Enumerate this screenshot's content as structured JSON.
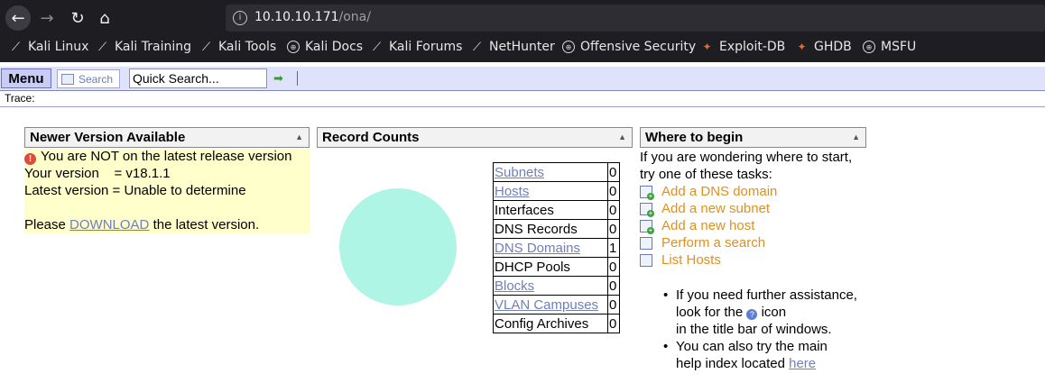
{
  "browser": {
    "url_host": "10.10.10.171",
    "url_path": "/ona/",
    "bookmarks": [
      {
        "label": "Kali Linux",
        "icon": "kali-dragon-icon"
      },
      {
        "label": "Kali Training",
        "icon": "kali-dragon-icon"
      },
      {
        "label": "Kali Tools",
        "icon": "kali-dragon-icon"
      },
      {
        "label": "Kali Docs",
        "icon": "globe-icon"
      },
      {
        "label": "Kali Forums",
        "icon": "kali-dragon-icon"
      },
      {
        "label": "NetHunter",
        "icon": "kali-dragon-icon"
      },
      {
        "label": "Offensive Security",
        "icon": "globe-icon"
      },
      {
        "label": "Exploit-DB",
        "icon": "exploit-db-icon"
      },
      {
        "label": "GHDB",
        "icon": "exploit-db-icon"
      },
      {
        "label": "MSFU",
        "icon": "globe-icon"
      }
    ]
  },
  "toolbar": {
    "menu_label": "Menu",
    "search_label": "Search",
    "quick_search_value": "Quick Search...",
    "trace_label": "Trace:"
  },
  "newer_version": {
    "title": "Newer Version Available",
    "warning": "You are NOT on the latest release version",
    "your_version": "Your version    = v18.1.1",
    "latest_version": "Latest version = Unable to determine",
    "please": "Please",
    "download_link": "DOWNLOAD",
    "after_link": "the latest version."
  },
  "record_counts": {
    "title": "Record Counts",
    "rows": [
      {
        "name": "Subnets",
        "count": "0",
        "link": true
      },
      {
        "name": "Hosts",
        "count": "0",
        "link": true
      },
      {
        "name": "Interfaces",
        "count": "0",
        "link": false
      },
      {
        "name": "DNS Records",
        "count": "0",
        "link": false
      },
      {
        "name": "DNS Domains",
        "count": "1",
        "link": true
      },
      {
        "name": "DHCP Pools",
        "count": "0",
        "link": false
      },
      {
        "name": "Blocks",
        "count": "0",
        "link": true
      },
      {
        "name": "VLAN Campuses",
        "count": "0",
        "link": true
      },
      {
        "name": "Config Archives",
        "count": "0",
        "link": false
      }
    ]
  },
  "where_to_begin": {
    "title": "Where to begin",
    "intro_1": "If you are wondering where to start,",
    "intro_2": "try one of these tasks:",
    "tasks": [
      "Add a DNS domain",
      "Add a new subnet",
      "Add a new host",
      "Perform a search",
      "List Hosts"
    ],
    "bullet_1_line_1": "If you need further assistance,",
    "bullet_1_line_2_a": "look for the",
    "bullet_1_line_2_b": "icon",
    "bullet_1_line_3": "in the title bar of windows.",
    "bullet_2_line_1": "You can also try the main",
    "bullet_2_line_2": "help index located",
    "help_link": "here"
  }
}
